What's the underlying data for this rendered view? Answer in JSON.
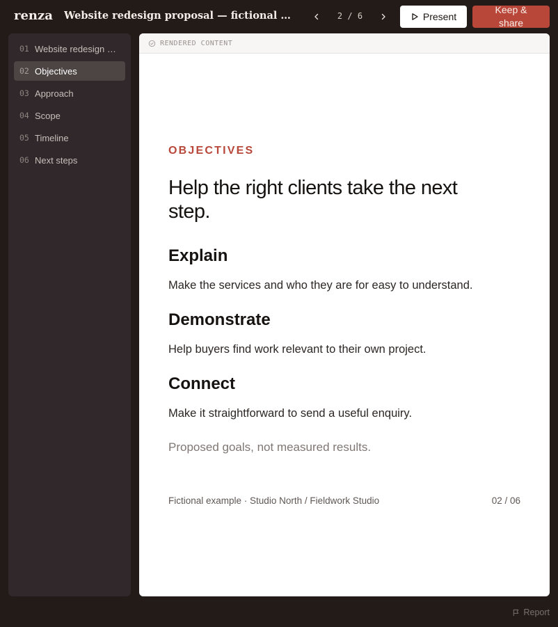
{
  "app": {
    "logo": "renza",
    "doc_title": "Website redesign proposal — fictional example"
  },
  "pager": {
    "current": "2",
    "separator": "/",
    "total": "6"
  },
  "actions": {
    "present_label": "Present",
    "keep_label": "Keep & share"
  },
  "sidebar": {
    "items": [
      {
        "num": "01",
        "label": "Website redesign proposal"
      },
      {
        "num": "02",
        "label": "Objectives"
      },
      {
        "num": "03",
        "label": "Approach"
      },
      {
        "num": "04",
        "label": "Scope"
      },
      {
        "num": "05",
        "label": "Timeline"
      },
      {
        "num": "06",
        "label": "Next steps"
      }
    ]
  },
  "main": {
    "header_label": "RENDERED CONTENT",
    "slide": {
      "eyebrow": "OBJECTIVES",
      "headline": "Help the right clients take the next step.",
      "sections": [
        {
          "title": "Explain",
          "body": "Make the services and who they are for easy to understand."
        },
        {
          "title": "Demonstrate",
          "body": "Help buyers find work relevant to their own project."
        },
        {
          "title": "Connect",
          "body": "Make it straightforward to send a useful enquiry."
        }
      ],
      "note": "Proposed goals, not measured results.",
      "footer_left": "Fictional example · Studio North / Fieldwork Studio",
      "footer_right": "02 / 06"
    }
  },
  "report_label": "Report",
  "colors": {
    "accent": "#b8473a",
    "background": "#231b18",
    "sidebar": "#30282a"
  }
}
